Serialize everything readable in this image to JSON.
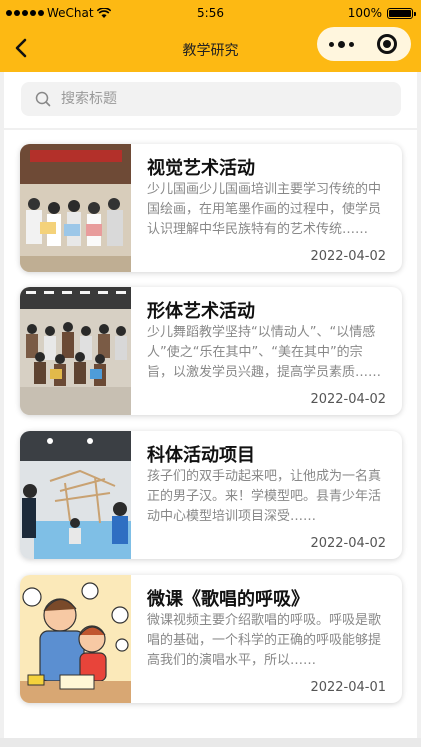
{
  "status_bar": {
    "carrier": "WeChat",
    "time": "5:56",
    "battery_text": "100%"
  },
  "nav": {
    "title": "教学研究",
    "back_icon": "chevron-left-icon",
    "more_icon": "more-dots-icon",
    "close_icon": "target-icon"
  },
  "search": {
    "placeholder": "搜索标题",
    "value": "",
    "icon": "search-icon"
  },
  "articles": [
    {
      "title": "视觉艺术活动",
      "desc": "少儿国画少儿国画培训主要学习传统的中国绘画，在用笔墨作画的过程中，使学员认识理解中华民族特有的艺术传统……",
      "date": "2022-04-02"
    },
    {
      "title": "形体艺术活动",
      "desc": "少儿舞蹈教学坚持“以情动人”、“以情感人”使之“乐在其中”、“美在其中”的宗旨，以激发学员兴趣，提高学员素质……",
      "date": "2022-04-02"
    },
    {
      "title": "科体活动项目",
      "desc": "孩子们的双手动起来吧，让他成为一名真正的男子汉。来！学模型吧。县青少年活动中心模型培训项目深受……",
      "date": "2022-04-02"
    },
    {
      "title": "微课《歌唱的呼吸》",
      "desc": "微课视频主要介绍歌唱的呼吸。呼吸是歌唱的基础，一个科学的正确的呼吸能够提高我们的演唱水平，所以……",
      "date": "2022-04-01"
    }
  ],
  "colors": {
    "accent": "#fdb913",
    "capsule": "#fff6de",
    "page_bg": "#f0f0f0"
  }
}
